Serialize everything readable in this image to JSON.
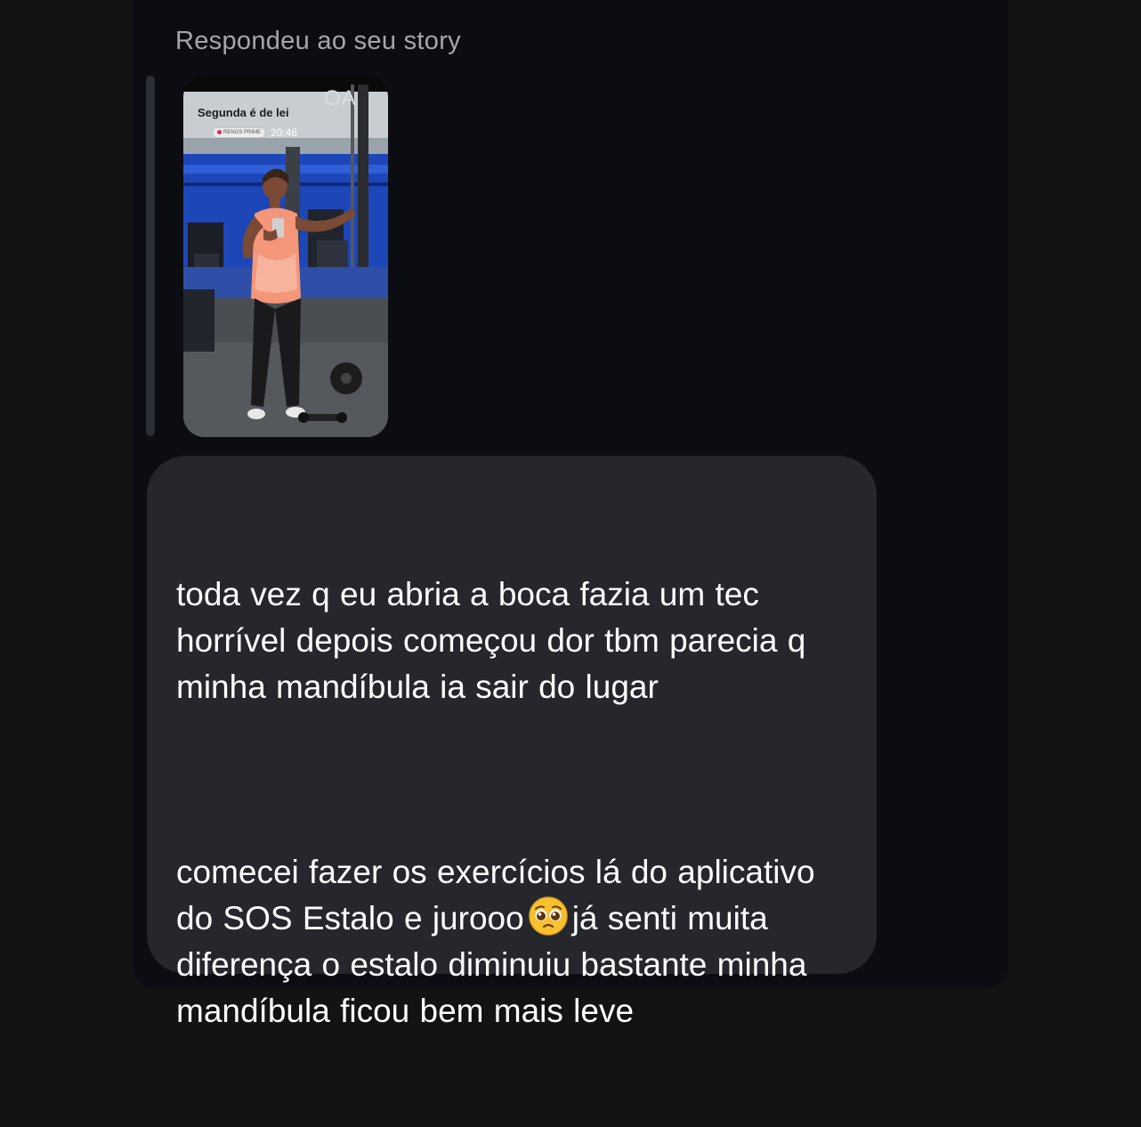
{
  "reply_label": "Respondeu ao seu story",
  "story": {
    "caption": "Segunda é de lei",
    "badge": "RENOS PRIME",
    "time": "20:46",
    "sign_text": "OA",
    "description_icon": "story-photo"
  },
  "message": {
    "paragraph1": "toda vez q eu abria a boca fazia um tec horrível depois começou dor tbm parecia q minha mandíbula ia sair do lugar",
    "paragraph2_before_emoji": "comecei fazer os exercícios lá do aplicativo  do SOS Estalo e jurooo",
    "emoji": "pleading-face-icon",
    "paragraph2_after_emoji": "já senti muita diferença o estalo diminuiu bastante minha mandíbula ficou bem mais leve"
  },
  "colors": {
    "page_bg": "#131313",
    "panel_bg": "#0b0d12",
    "bubble_bg": "#25272c",
    "label_text": "#a4a7ad",
    "message_text": "#ffffff"
  }
}
